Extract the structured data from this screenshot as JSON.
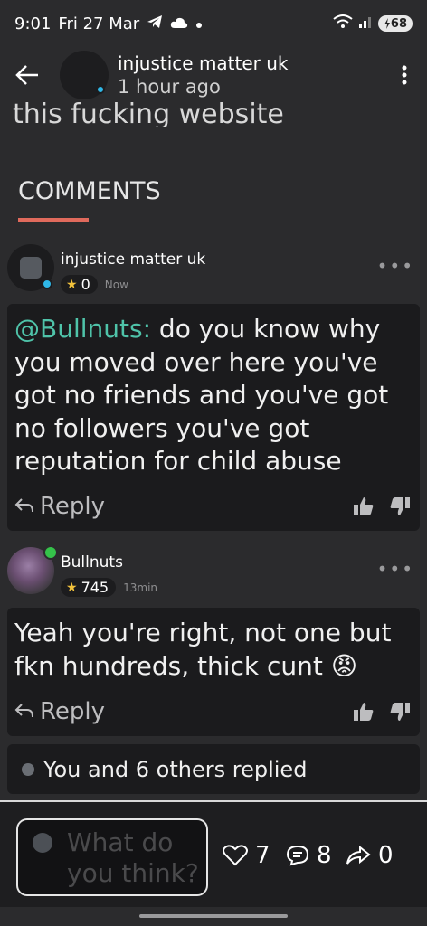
{
  "status_bar": {
    "time": "9:01",
    "date": "Fri 27 Mar",
    "battery": "68"
  },
  "header": {
    "title": "injustice matter uk",
    "subtitle": "1 hour ago"
  },
  "post_fragment": "this fucking website",
  "comments_section": {
    "heading": "COMMENTS"
  },
  "comments": [
    {
      "author": "injustice matter uk",
      "reputation": "0",
      "time": "Now",
      "mention": "@Bullnuts:",
      "text": " do you know why you moved over here you've got no friends and you've got no followers you've got reputation for child abuse",
      "reply_label": "Reply"
    },
    {
      "author": "Bullnuts",
      "reputation": "745",
      "time": "13min",
      "text": "Yeah you're right, not one but fkn hundreds, thick cunt",
      "emoji": "😡",
      "reply_label": "Reply"
    }
  ],
  "replies_summary": "You and 6 others replied",
  "composer": {
    "placeholder": "What do you think?"
  },
  "stats": {
    "likes": "7",
    "comments": "8",
    "shares": "0"
  },
  "colors": {
    "mention": "#4fc3a9",
    "accent_underline": "#e06a5c",
    "star": "#f3c33c",
    "online": "#35c24a"
  }
}
